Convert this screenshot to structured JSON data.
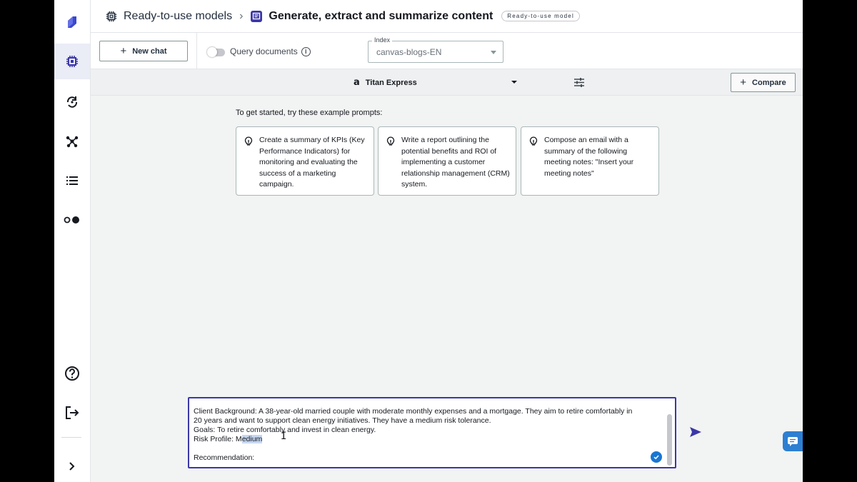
{
  "breadcrumb": {
    "root": "Ready-to-use models",
    "current": "Generate, extract and summarize content",
    "badge": "Ready-to-use model"
  },
  "toolbar": {
    "new_chat_label": "New chat",
    "query_documents_label": "Query documents",
    "query_documents_enabled": false,
    "index_label": "Index",
    "index_value": "canvas-blogs-EN"
  },
  "model_bar": {
    "model_name": "Titan Express",
    "compare_label": "Compare"
  },
  "prompts": {
    "intro": "To get started, try these example prompts:",
    "cards": [
      "Create a summary of KPIs (Key Performance Indicators) for monitoring and evaluating the success of a marketing campaign.",
      "Write a report outlining the potential benefits and ROI of implementing a customer relationship management (CRM) system.",
      "Compose an email with a summary of the following meeting notes: \"Insert your meeting notes\""
    ]
  },
  "input": {
    "line1": "Client Background: A 38-year-old married couple with moderate monthly expenses and a mortgage. They aim to retire comfortably in",
    "line2": "20 years and want to support clean energy initiatives. They have a medium risk tolerance.",
    "line3": "Goals: To retire comfortably and invest in clean energy.",
    "line4_prefix": "Risk Profile: M",
    "line4_selected": "edium",
    "line6": "Recommendation:"
  },
  "colors": {
    "accent": "#3b37a8",
    "brand_logo": "#3b48cc",
    "check": "#1976d2",
    "chat_bubble": "#2d7fd2"
  },
  "icons": {
    "sidebar": [
      "canvas-logo-icon",
      "chip-icon",
      "refresh-cycle-icon",
      "network-nodes-icon",
      "list-icon",
      "toggle-dots-icon",
      "help-icon",
      "sign-out-icon",
      "chevron-right-icon"
    ]
  }
}
